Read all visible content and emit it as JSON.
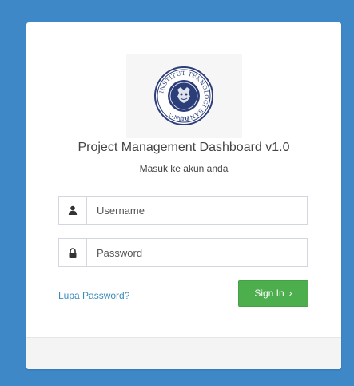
{
  "colors": {
    "page_background": "#3f88c8",
    "card_background": "#ffffff",
    "link": "#3c8dbc",
    "signin_button": "#4cae4c",
    "footer_background": "#f4f4f4"
  },
  "header": {
    "logo": {
      "name": "institute-seal-icon",
      "ring_text": "INSTITUT TEKNOLOGI BANDUNG",
      "year": "1920"
    },
    "title": "Project Management Dashboard v1.0",
    "subtitle": "Masuk ke akun anda"
  },
  "form": {
    "username": {
      "icon": "user-icon",
      "placeholder": "Username",
      "value": ""
    },
    "password": {
      "icon": "lock-icon",
      "placeholder": "Password",
      "value": ""
    },
    "forgot_password_label": "Lupa Password?",
    "signin_label": "Sign In",
    "signin_icon": "chevron-right-icon",
    "signin_chevron": "›"
  }
}
